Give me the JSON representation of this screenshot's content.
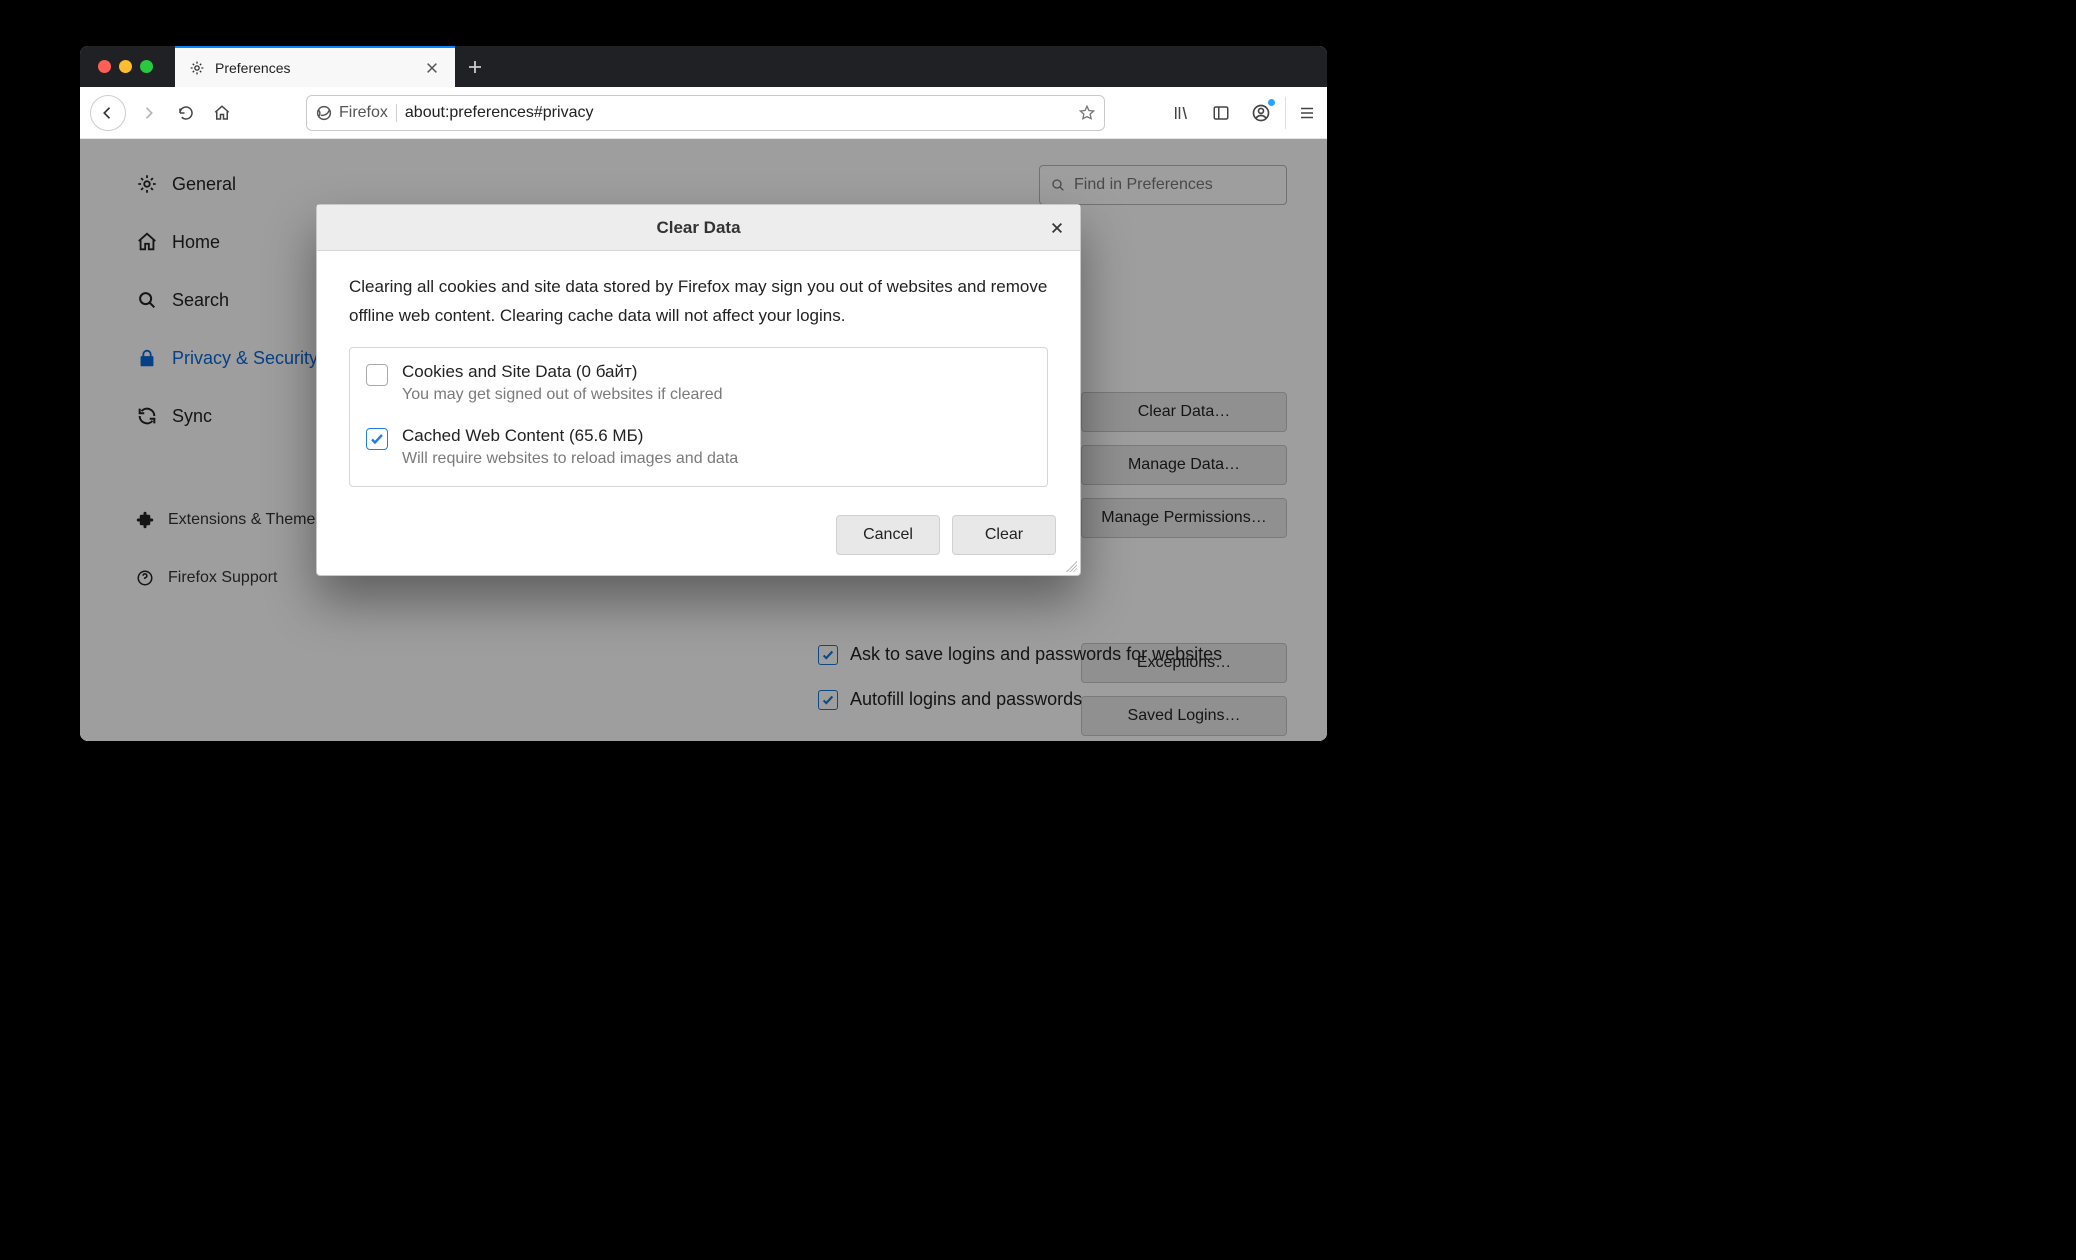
{
  "tab": {
    "title": "Preferences"
  },
  "urlbar": {
    "identity": "Firefox",
    "url": "about:preferences#privacy"
  },
  "sidebar": {
    "general": "General",
    "home": "Home",
    "search": "Search",
    "privacy": "Privacy & Security",
    "sync": "Sync",
    "extensions": "Extensions & Themes",
    "support": "Firefox Support"
  },
  "findbox": {
    "placeholder": "Find in Preferences"
  },
  "buttons": {
    "clear_data": "Clear Data…",
    "manage_data": "Manage Data…",
    "manage_permissions": "Manage Permissions…",
    "exceptions": "Exceptions…",
    "saved_logins": "Saved Logins…"
  },
  "bg": {
    "ask_save": "Ask to save logins and passwords for websites",
    "autofill": "Autofill logins and passwords"
  },
  "dialog": {
    "title": "Clear Data",
    "desc": "Clearing all cookies and site data stored by Firefox may sign you out of websites and remove offline web content. Clearing cache data will not affect your logins.",
    "opt1": {
      "title": "Cookies and Site Data (0 байт)",
      "sub": "You may get signed out of websites if cleared",
      "checked": false
    },
    "opt2": {
      "title": "Cached Web Content (65.6 МБ)",
      "sub": "Will require websites to reload images and data",
      "checked": true
    },
    "cancel": "Cancel",
    "clear": "Clear"
  }
}
